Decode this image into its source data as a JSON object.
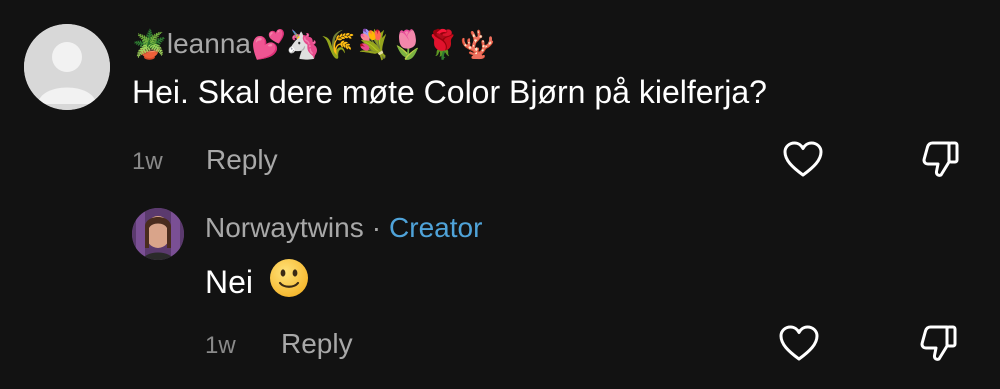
{
  "comment": {
    "username": "leanna",
    "username_prefix_emoji": "🪴",
    "username_suffix_emojis": "💕🦄🌾💐🌷🌹🪸",
    "text": "Hei. Skal dere møte Color Bjørn på kielferja?",
    "time": "1w",
    "reply_label": "Reply"
  },
  "reply": {
    "username": "Norwaytwins",
    "separator": "·",
    "badge": "Creator",
    "text": "Nei",
    "time": "1w",
    "reply_label": "Reply"
  },
  "colors": {
    "background": "#121212",
    "secondary_text": "#a8a8a8",
    "creator_badge": "#4fa3d9"
  },
  "icons": [
    "default-avatar-icon",
    "heart-outline-icon",
    "thumbs-down-outline-icon",
    "slightly-smiling-face-icon"
  ]
}
